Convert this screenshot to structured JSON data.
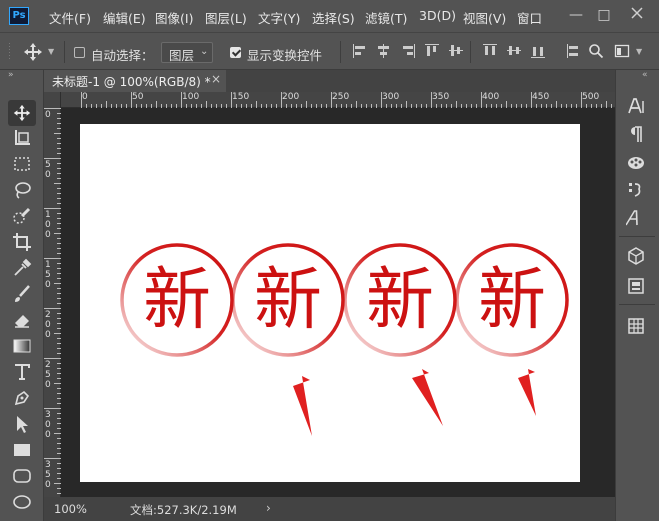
{
  "app": {
    "logo": "Ps"
  },
  "menu": {
    "items": [
      "文件(F)",
      "编辑(E)",
      "图像(I)",
      "图层(L)",
      "文字(Y)",
      "选择(S)",
      "滤镜(T)",
      "3D(D)",
      "视图(V)",
      "窗口"
    ],
    "window_controls": [
      "—",
      "□"
    ]
  },
  "options": {
    "auto_select_label": "自动选择：",
    "auto_select_checked": false,
    "auto_select_target": "图层",
    "show_transform_label": "显示变换控件",
    "show_transform_checked": true
  },
  "document": {
    "tab_title": "未标题-1 @ 100%(RGB/8) *",
    "tab_close": "×"
  },
  "rulers": {
    "h_ticks": [
      "0",
      "50",
      "100",
      "150",
      "200",
      "250",
      "300",
      "350",
      "400",
      "450",
      "500"
    ],
    "v_ticks": [
      "0",
      "5",
      "0",
      "1",
      "0",
      "0",
      "1",
      "5",
      "0",
      "2",
      "0",
      "0",
      "2",
      "5",
      "0",
      "3",
      "0",
      "0",
      "3",
      "5",
      "0"
    ]
  },
  "canvas": {
    "stamp_char": "新",
    "stamp_count": 4,
    "stamp_color": "#cc1111",
    "arrow_color": "#e02020"
  },
  "status": {
    "zoom": "100%",
    "doc_info": "文档:527.3K/2.19M",
    "arrow": "›"
  },
  "colors": {
    "ui_bg": "#535353",
    "workspace_bg": "#282828",
    "canvas_bg": "#ffffff"
  },
  "left_tools": [
    "move-tool-icon",
    "artboard-tool-icon",
    "marquee-tool-icon",
    "lasso-tool-icon",
    "quick-select-tool-icon",
    "crop-tool-icon",
    "eyedropper-tool-icon",
    "brush-tool-icon",
    "eraser-tool-icon",
    "gradient-tool-icon",
    "type-tool-icon",
    "pen-tool-icon",
    "path-select-tool-icon",
    "rectangle-tool-icon",
    "rounded-rect-tool-icon",
    "ellipse-tool-icon"
  ],
  "right_panels": [
    "character-panel-icon",
    "paragraph-panel-icon",
    "swatches-panel-icon",
    "glyphs-panel-icon",
    "character-styles-icon",
    "3d-panel-icon",
    "properties-panel-icon",
    "layers-panel-icon"
  ]
}
